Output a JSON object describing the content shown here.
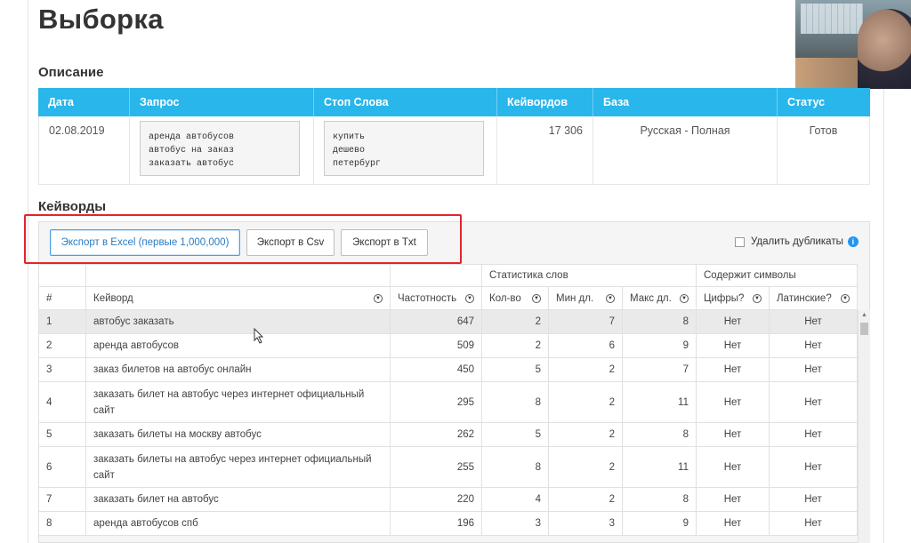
{
  "page": {
    "title": "Выборка"
  },
  "description": {
    "heading": "Описание",
    "columns": [
      "Дата",
      "Запрос",
      "Стоп Слова",
      "Кейвордов",
      "База",
      "Статус"
    ],
    "row": {
      "date": "02.08.2019",
      "query": "аренда автобусов\nавтобус на заказ\nзаказать автобус",
      "stop_words": "купить\nдешево\nпетербург",
      "keywords_count": "17 306",
      "base": "Русская - Полная",
      "status": "Готов"
    }
  },
  "keywords": {
    "heading": "Кейворды",
    "buttons": {
      "export_excel": "Экспорт в Excel (первые 1,000,000)",
      "export_csv": "Экспорт в Csv",
      "export_txt": "Экспорт в Txt"
    },
    "remove_duplicates_label": "Удалить дубликаты",
    "group_headers": {
      "word_stats": "Статистика слов",
      "contains_symbols": "Содержит символы"
    },
    "columns": [
      "#",
      "Кейворд",
      "Частотность",
      "Кол-во",
      "Мин дл.",
      "Макс дл.",
      "Цифры?",
      "Латинские?"
    ],
    "rows": [
      {
        "n": "1",
        "keyword": "автобус заказать",
        "freq": "647",
        "count": "2",
        "min": "7",
        "max": "8",
        "digits": "Нет",
        "latin": "Нет"
      },
      {
        "n": "2",
        "keyword": "аренда автобусов",
        "freq": "509",
        "count": "2",
        "min": "6",
        "max": "9",
        "digits": "Нет",
        "latin": "Нет"
      },
      {
        "n": "3",
        "keyword": "заказ билетов на автобус онлайн",
        "freq": "450",
        "count": "5",
        "min": "2",
        "max": "7",
        "digits": "Нет",
        "latin": "Нет"
      },
      {
        "n": "4",
        "keyword": "заказать билет на автобус через интернет официальный сайт",
        "freq": "295",
        "count": "8",
        "min": "2",
        "max": "11",
        "digits": "Нет",
        "latin": "Нет"
      },
      {
        "n": "5",
        "keyword": "заказать билеты на москву автобус",
        "freq": "262",
        "count": "5",
        "min": "2",
        "max": "8",
        "digits": "Нет",
        "latin": "Нет"
      },
      {
        "n": "6",
        "keyword": "заказать билеты на автобус через интернет официальный сайт",
        "freq": "255",
        "count": "8",
        "min": "2",
        "max": "11",
        "digits": "Нет",
        "latin": "Нет"
      },
      {
        "n": "7",
        "keyword": "заказать билет на автобус",
        "freq": "220",
        "count": "4",
        "min": "2",
        "max": "8",
        "digits": "Нет",
        "latin": "Нет"
      },
      {
        "n": "8",
        "keyword": "аренда автобусов спб",
        "freq": "196",
        "count": "3",
        "min": "3",
        "max": "9",
        "digits": "Нет",
        "latin": "Нет"
      }
    ]
  },
  "colors": {
    "header_blue": "#29b6ea",
    "highlight_red": "#e3242b",
    "selected_row": "#eaeaea"
  },
  "icons": [
    "filter-icon",
    "info-icon",
    "checkbox",
    "mouse-cursor-icon",
    "scroll-up-arrow-icon"
  ]
}
